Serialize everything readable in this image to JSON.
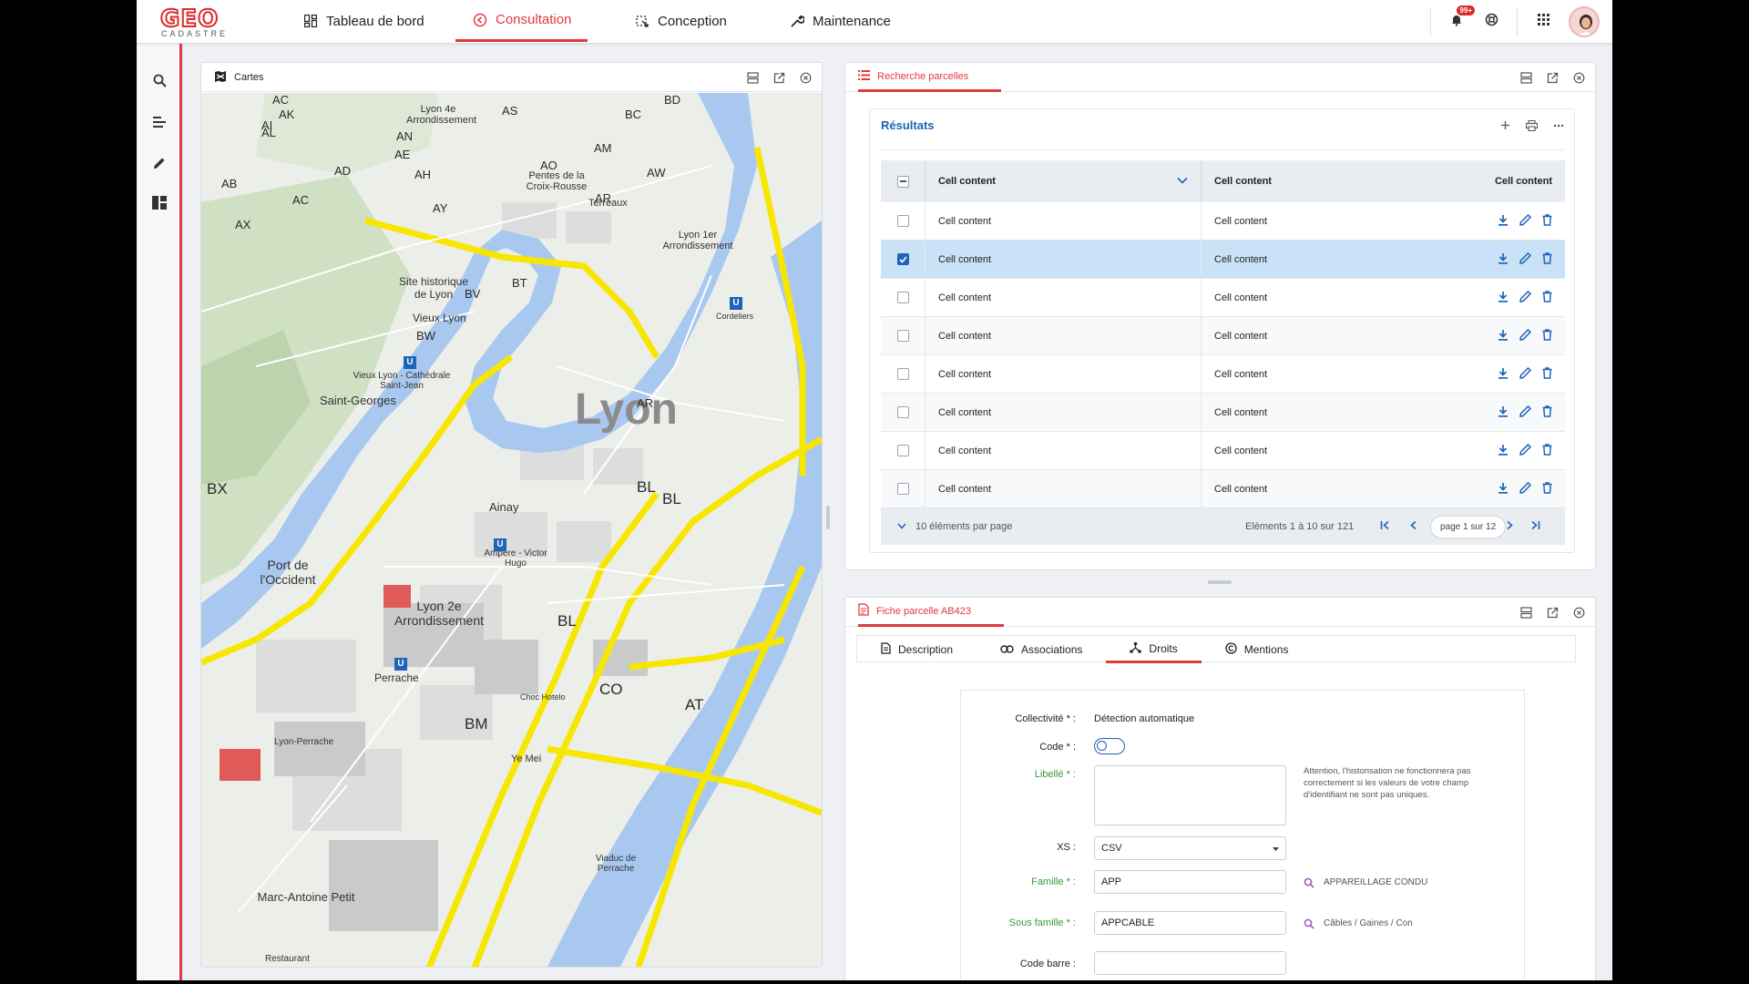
{
  "brand": {
    "logo_text": "GEO",
    "logo_sub": "CADASTRE"
  },
  "nav": [
    {
      "label": "Tableau de bord",
      "icon": "dashboard-icon"
    },
    {
      "label": "Consultation",
      "icon": "consultation-icon",
      "active": true
    },
    {
      "label": "Conception",
      "icon": "conception-icon"
    },
    {
      "label": "Maintenance",
      "icon": "wrench-icon"
    }
  ],
  "topbar": {
    "notif_badge": "99+"
  },
  "rail": [
    "search-icon",
    "list-icon",
    "pencil-icon",
    "layout-icon"
  ],
  "map_panel": {
    "title": "Cartes",
    "map_labels": {
      "city": "Lyon",
      "l1": "Vieux Lyon",
      "l2": "Site historique de Lyon",
      "l3": "Saint-Georges",
      "l4": "Ainay",
      "l5": "Lyon 2e Arrondissement",
      "l6": "Perrache",
      "l7": "Port de l'Occident",
      "l8": "Marc-Antoine Petit",
      "l9": "Lyon 4e Arrondissement",
      "l10": "Terreaux",
      "l11": "Lyon 1er Arrondissement",
      "l12": "Pentes de la Croix-Rousse",
      "l13": "Vieux Lyon - Cathédrale Saint-Jean",
      "l14": "Ampère - Victor Hugo",
      "l15": "Lyon-Perrache",
      "l16": "Viaduc de Perrache",
      "l17": "Cordeliers",
      "l18": "Restaurant",
      "l19": "Choc Hotelo",
      "l20": "Ye Mei"
    },
    "grid_codes": [
      "AC",
      "AK",
      "AB",
      "AD",
      "AH",
      "AL",
      "AN",
      "AE",
      "AY",
      "AS",
      "AO",
      "AM",
      "BC",
      "BD",
      "AR",
      "AW",
      "AX",
      "AC",
      "AI",
      "BV",
      "BT",
      "BW",
      "AR",
      "BX",
      "BL",
      "BL",
      "BL",
      "BM",
      "CO",
      "AT"
    ]
  },
  "results_panel": {
    "title": "Recherche parcelles",
    "card_title": "Résultats",
    "columns": [
      "Cell content",
      "Cell content",
      "Cell content"
    ],
    "rows": [
      {
        "c1": "Cell content",
        "c2": "Cell content",
        "selected": false
      },
      {
        "c1": "Cell content",
        "c2": "Cell content",
        "selected": true
      },
      {
        "c1": "Cell content",
        "c2": "Cell content",
        "selected": false
      },
      {
        "c1": "Cell content",
        "c2": "Cell content",
        "selected": false
      },
      {
        "c1": "Cell content",
        "c2": "Cell content",
        "selected": false
      },
      {
        "c1": "Cell content",
        "c2": "Cell content",
        "selected": false
      },
      {
        "c1": "Cell content",
        "c2": "Cell content",
        "selected": false
      },
      {
        "c1": "Cell content",
        "c2": "Cell content",
        "selected": false
      }
    ],
    "footer": {
      "per_page": "10 éléments par page",
      "range": "Eléments 1 à 10 sur 121",
      "page": "page 1 sur 12"
    }
  },
  "fiche_panel": {
    "title": "Fiche parcelle AB423",
    "tabs": [
      {
        "label": "Description",
        "icon": "document-icon"
      },
      {
        "label": "Associations",
        "icon": "link-icon"
      },
      {
        "label": "Droits",
        "icon": "share-icon",
        "active": true
      },
      {
        "label": "Mentions",
        "icon": "copyright-icon"
      }
    ],
    "form": {
      "collectivite_label": "Collectivité * :",
      "collectivite_value": "Détection automatique",
      "code_label": "Code * :",
      "libelle_label": "Libellé * :",
      "libelle_hint": "Attention, l'historisation ne fonctionnera pas correctement si les valeurs de votre champ d'identifiant ne sont pas uniques.",
      "xs_label": "XS :",
      "xs_value": "CSV",
      "famille_label": "Famille * :",
      "famille_value": "APP",
      "famille_lookup": "APPAREILLAGE CONDU",
      "sousfamille_label": "Sous famille * :",
      "sousfamille_value": "APPCABLE",
      "sousfamille_lookup": "Câbles / Gaines / Con",
      "codebarre_label": "Code barre :"
    }
  },
  "colors": {
    "accent": "#e0393e",
    "primary": "#1d63b8",
    "selected_row": "#c9e2f7",
    "green_label": "#3a9a3a"
  }
}
